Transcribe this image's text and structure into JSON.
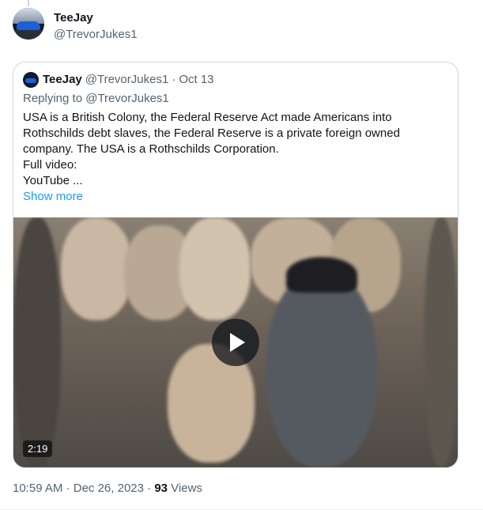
{
  "author": {
    "display_name": "TeeJay",
    "handle": "@TrevorJukes1"
  },
  "quoted_tweet": {
    "display_name": "TeeJay",
    "handle": "@TrevorJukes1",
    "separator": "·",
    "date": "Oct 13",
    "replying_to_label": "Replying to",
    "replying_to_handle": "@TrevorJukes1",
    "text_lines": [
      "USA is a British Colony, the Federal Reserve Act made Americans into",
      "Rothschilds debt slaves, the Federal Reserve is a private foreign owned",
      "company. The USA is a Rothschilds Corporation.",
      "Full video:",
      "YouTube ..."
    ],
    "show_more": "Show more",
    "video": {
      "duration": "2:19",
      "play_icon": "play-icon"
    }
  },
  "meta": {
    "time": "10:59 AM",
    "separator": "·",
    "date": "Dec 26, 2023",
    "views_count": "93",
    "views_label": "Views"
  },
  "colors": {
    "accent": "#1d9bf0",
    "secondary_text": "#536471",
    "border": "#cfd9de"
  }
}
